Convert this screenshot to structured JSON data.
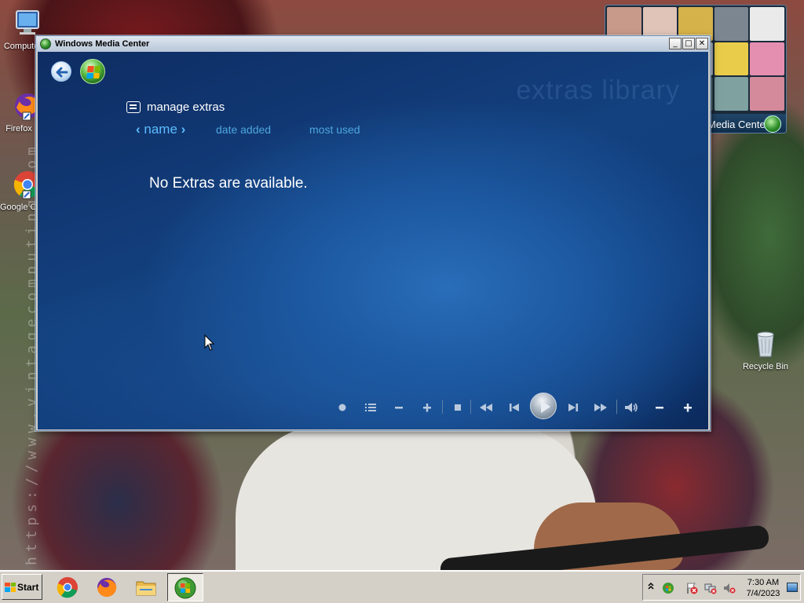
{
  "desktop": {
    "watermark": "https://www.vintagecomputing.com",
    "icons": [
      {
        "label": "Computer"
      },
      {
        "label": "Firefox"
      },
      {
        "label": "Google Chrome"
      },
      {
        "label": "Recycle Bin"
      }
    ]
  },
  "gadget": {
    "caption": "Media Center"
  },
  "window": {
    "title": "Windows Media Center",
    "controls": {
      "minimize": "_",
      "maximize": "□",
      "close": "✕"
    }
  },
  "mediacenter": {
    "library_title": "extras library",
    "section_label": "manage extras",
    "sort": {
      "active": "name",
      "options": [
        "date added",
        "most used"
      ]
    },
    "empty_message": "No Extras are available."
  },
  "transport": {
    "buttons": [
      "record",
      "guide",
      "channel-down",
      "channel-up",
      "stop",
      "rewind",
      "skip-back",
      "play",
      "skip-forward",
      "fast-forward",
      "mute",
      "volume-down",
      "volume-up"
    ]
  },
  "taskbar": {
    "start_label": "Start",
    "apps": [
      "Google Chrome",
      "Firefox",
      "File Explorer",
      "Windows Media Center"
    ],
    "clock_time": "7:30 AM",
    "clock_date": "7/4/2023"
  },
  "colors": {
    "mc_background": "#13417f",
    "mc_accent": "#5cbcff",
    "taskbar": "#d4d0c8"
  }
}
